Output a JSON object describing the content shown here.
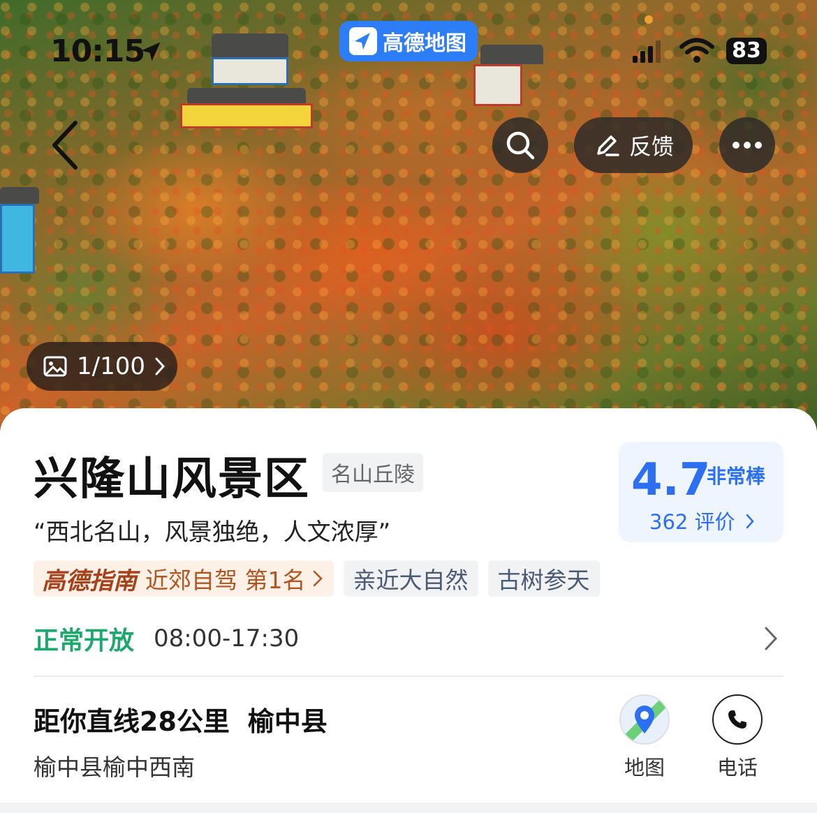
{
  "status_bar": {
    "time": "10:15",
    "battery": "83"
  },
  "app_badge": {
    "label": "高德地图"
  },
  "header": {
    "feedback_label": "反馈"
  },
  "gallery": {
    "counter": "1/100"
  },
  "poi": {
    "name": "兴隆山风景区",
    "category": "名山丘陵",
    "slogan": "“西北名山，风景独绝，人文浓厚”",
    "rating": {
      "score": "4.7",
      "text": "非常棒",
      "count": "362 评价"
    },
    "tags": {
      "guide_logo": "高德指南",
      "guide_rank": "近郊自驾 第1名",
      "other": [
        "亲近大自然",
        "古树参天"
      ]
    },
    "hours": {
      "status": "正常开放",
      "time": "08:00-17:30"
    },
    "distance": "距你直线28公里",
    "district": "榆中县",
    "address": "榆中县榆中西南"
  },
  "actions": {
    "map_label": "地图",
    "phone_label": "电话"
  },
  "colors": {
    "accent_blue": "#2c6ff0",
    "open_green": "#1fa86e",
    "guide_brown": "#a5421c"
  }
}
